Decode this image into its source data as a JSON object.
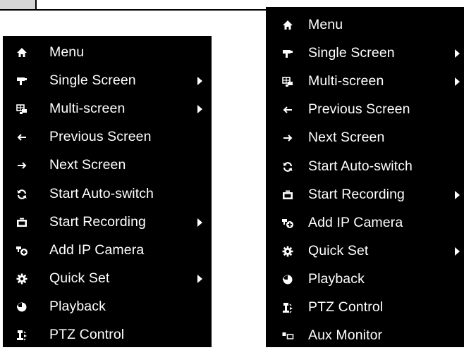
{
  "colors": {
    "menu_bg": "#000000",
    "menu_text": "#ffffff",
    "page_bg": "#ffffff"
  },
  "left_menu": {
    "items": [
      {
        "icon": "home-icon",
        "label": "Menu",
        "submenu": false
      },
      {
        "icon": "single-screen-icon",
        "label": "Single Screen",
        "submenu": true
      },
      {
        "icon": "multi-screen-icon",
        "label": "Multi-screen",
        "submenu": true
      },
      {
        "icon": "arrow-left-icon",
        "label": "Previous Screen",
        "submenu": false
      },
      {
        "icon": "arrow-right-icon",
        "label": "Next Screen",
        "submenu": false
      },
      {
        "icon": "refresh-icon",
        "label": "Start Auto-switch",
        "submenu": false
      },
      {
        "icon": "record-icon",
        "label": "Start Recording",
        "submenu": true
      },
      {
        "icon": "add-camera-icon",
        "label": "Add IP Camera",
        "submenu": false
      },
      {
        "icon": "gear-icon",
        "label": "Quick Set",
        "submenu": true
      },
      {
        "icon": "playback-icon",
        "label": "Playback",
        "submenu": false
      },
      {
        "icon": "ptz-icon",
        "label": "PTZ Control",
        "submenu": false
      }
    ]
  },
  "right_menu": {
    "items": [
      {
        "icon": "home-icon",
        "label": "Menu",
        "submenu": false
      },
      {
        "icon": "single-screen-icon",
        "label": "Single Screen",
        "submenu": true
      },
      {
        "icon": "multi-screen-icon",
        "label": "Multi-screen",
        "submenu": true
      },
      {
        "icon": "arrow-left-icon",
        "label": "Previous Screen",
        "submenu": false
      },
      {
        "icon": "arrow-right-icon",
        "label": "Next Screen",
        "submenu": false
      },
      {
        "icon": "refresh-icon",
        "label": "Start Auto-switch",
        "submenu": false
      },
      {
        "icon": "record-icon",
        "label": "Start Recording",
        "submenu": true
      },
      {
        "icon": "add-camera-icon",
        "label": "Add IP Camera",
        "submenu": false
      },
      {
        "icon": "gear-icon",
        "label": "Quick Set",
        "submenu": true
      },
      {
        "icon": "playback-icon",
        "label": "Playback",
        "submenu": false
      },
      {
        "icon": "ptz-icon",
        "label": "PTZ Control",
        "submenu": false
      },
      {
        "icon": "aux-monitor-icon",
        "label": "Aux Monitor",
        "submenu": false
      }
    ]
  }
}
